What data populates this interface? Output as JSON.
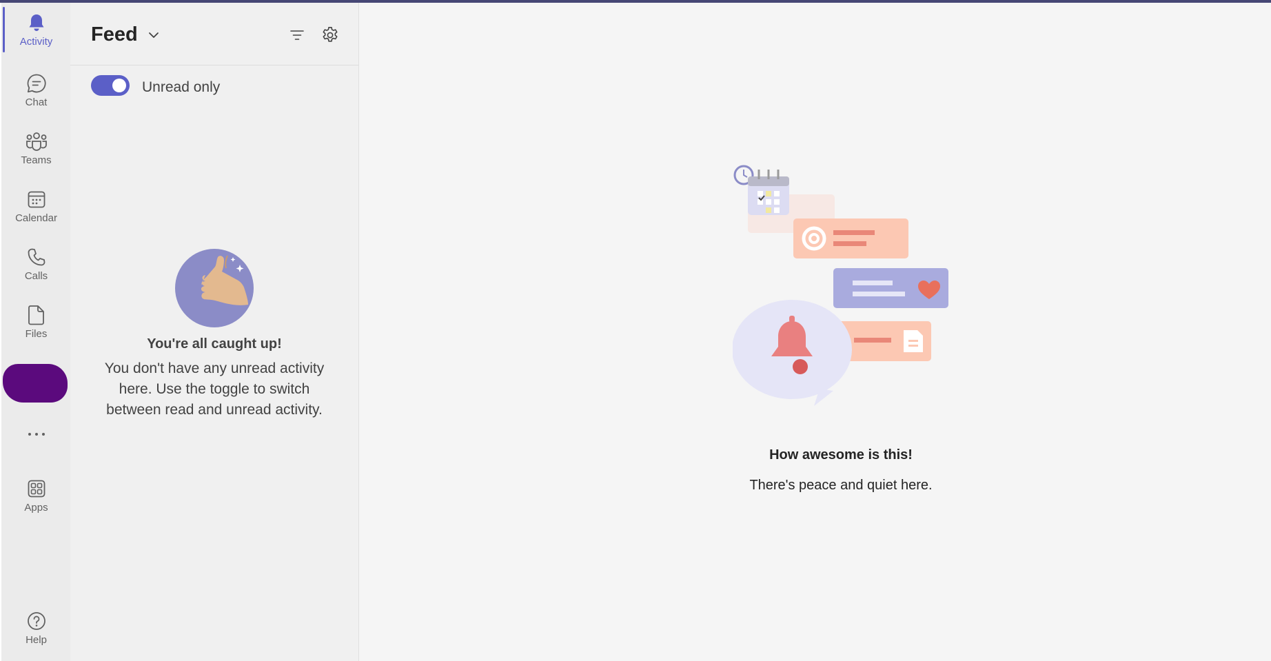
{
  "rail": {
    "items": [
      {
        "label": "Activity",
        "icon": "bell-icon"
      },
      {
        "label": "Chat",
        "icon": "chat-icon"
      },
      {
        "label": "Teams",
        "icon": "teams-icon"
      },
      {
        "label": "Calendar",
        "icon": "calendar-icon"
      },
      {
        "label": "Calls",
        "icon": "phone-icon"
      },
      {
        "label": "Files",
        "icon": "file-icon"
      },
      {
        "label": "Apps",
        "icon": "apps-icon"
      },
      {
        "label": "Help",
        "icon": "help-icon"
      }
    ],
    "more_icon": "more-horizontal-icon",
    "active_color": "#5b5fc7"
  },
  "feed": {
    "title": "Feed",
    "toggle_label": "Unread only",
    "toggle_on": true,
    "caught_up_title": "You're all caught up!",
    "caught_up_body": "You don't have any unread activity here. Use the toggle to switch between read and unread activity."
  },
  "main": {
    "title": "How awesome is this!",
    "subtitle": "There's peace and quiet here."
  },
  "colors": {
    "accent": "#5b5fc7",
    "top_bar": "#464775"
  }
}
